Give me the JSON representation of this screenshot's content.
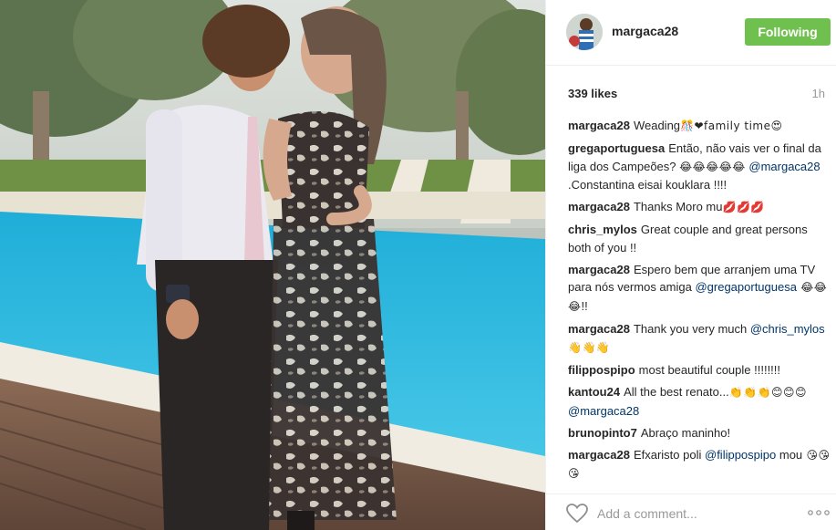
{
  "post": {
    "username": "margaca28",
    "follow_label": "Following",
    "likes": "339 likes",
    "time": "1h",
    "add_comment_placeholder": "Add a comment...",
    "colors": {
      "following_green": "#70c050",
      "mention": "#003569",
      "muted": "#999999"
    }
  },
  "comments": [
    {
      "user": "margaca28",
      "text": "Weading",
      "emoji": "🎊❤family time😍"
    },
    {
      "user": "gregaportuguesa",
      "text": "Então, não vais ver o final da liga dos Campeões? ",
      "emoji": "😂😂😂😂😂",
      "mention": "@margaca28",
      "after": " .Constantina eisai kouklara !!!!"
    },
    {
      "user": "margaca28",
      "text": "Thanks Moro mu",
      "emoji": "💋💋💋"
    },
    {
      "user": "chris_mylos",
      "text": "Great couple and great persons both of you !!"
    },
    {
      "user": "margaca28",
      "text": "Espero bem que arranjem uma TV para nós vermos amiga ",
      "mention": "@gregaportuguesa",
      "after_emoji": " 😂😂😂",
      "after": "!!"
    },
    {
      "user": "margaca28",
      "text": "Thank you very much ",
      "mention": "@chris_mylos",
      "after_emoji": " 👋👋👋"
    },
    {
      "user": "filippospipo",
      "text": "most beautiful couple !!!!!!!!"
    },
    {
      "user": "kantou24",
      "text": "All the best renato...",
      "emoji": "👏👏👏😊😊😊 ",
      "mention": "@margaca28"
    },
    {
      "user": "brunopinto7",
      "text": "Abraço maninho!"
    },
    {
      "user": "margaca28",
      "text": "Efxaristo poli ",
      "mention": "@filippospipo",
      "after": " mou",
      "after_emoji": " 😘😘😘"
    }
  ]
}
